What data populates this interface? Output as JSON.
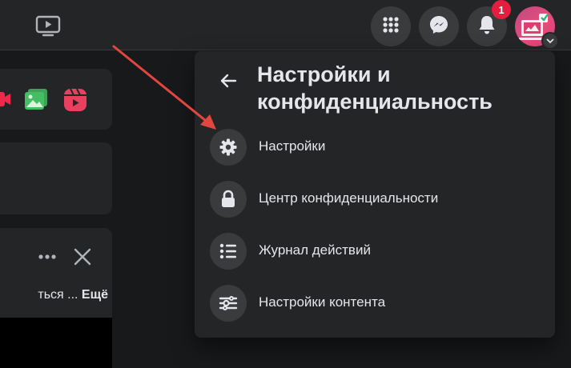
{
  "topbar": {
    "watch_icon": "video-play-icon",
    "menu_icon": "grid-menu-icon",
    "messenger_icon": "messenger-icon",
    "notifications_icon": "bell-icon",
    "notification_count": "1",
    "avatar_caret_icon": "chevron-down-icon"
  },
  "feed": {
    "post_snippet": "ться ... ",
    "post_more_label": "Ещё"
  },
  "panel": {
    "title": "Настройки и конфиденциальность",
    "back_icon": "arrow-left-icon",
    "items": [
      {
        "label": "Настройки",
        "icon": "gear-icon"
      },
      {
        "label": "Центр конфиденциальности",
        "icon": "lock-icon"
      },
      {
        "label": "Журнал действий",
        "icon": "list-icon"
      },
      {
        "label": "Настройки контента",
        "icon": "sliders-icon"
      }
    ]
  },
  "colors": {
    "background": "#18191a",
    "surface": "#242526",
    "icon_circle": "#3a3b3c",
    "text": "#e4e6eb",
    "badge": "#e41e3f",
    "annotation_arrow": "#e2463f"
  }
}
